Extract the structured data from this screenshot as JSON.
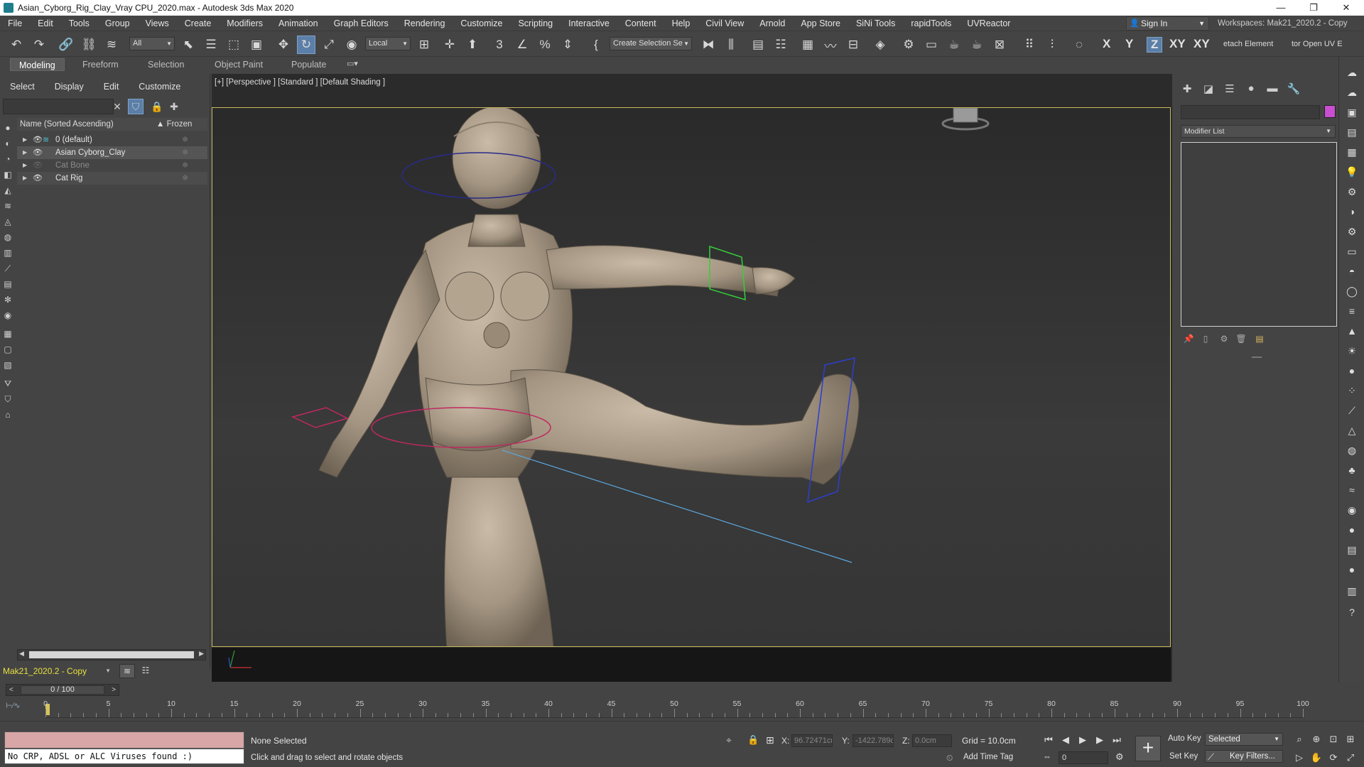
{
  "window": {
    "title": "Asian_Cyborg_Rig_Clay_Vray CPU_2020.max - Autodesk 3ds Max 2020",
    "controls": [
      "—",
      "❐",
      "✕"
    ]
  },
  "menu": [
    "File",
    "Edit",
    "Tools",
    "Group",
    "Views",
    "Create",
    "Modifiers",
    "Animation",
    "Graph Editors",
    "Rendering",
    "Customize",
    "Scripting",
    "Interactive",
    "Content",
    "Help",
    "Civil View",
    "Arnold",
    "App Store",
    "SiNi Tools",
    "rapidTools",
    "UVReactor"
  ],
  "signin": "Sign In",
  "workspaces": {
    "label": "Workspaces:",
    "value": "Mak21_2020.2 - Copy"
  },
  "toolbar": {
    "filter": "All",
    "coord_system": "Local",
    "selection_set": "Create Selection Se",
    "axes": [
      "X",
      "Y",
      "Z",
      "XY",
      "XY"
    ],
    "active_axis": "Z",
    "detach_label": "etach Element",
    "openuv_label": "tor Open UV E"
  },
  "ribbon_tabs": [
    "Modeling",
    "Freeform",
    "Selection",
    "Object Paint",
    "Populate"
  ],
  "ribbon_active": "Modeling",
  "explorer": {
    "menu": [
      "Select",
      "Display",
      "Edit",
      "Customize"
    ],
    "header": {
      "name": "Name (Sorted Ascending)",
      "frozen": "▲ Frozen"
    },
    "rows": [
      {
        "name": "0 (default)",
        "dim": false
      },
      {
        "name": "Asian Cyborg_Clay",
        "dim": false
      },
      {
        "name": "Cat Bone",
        "dim": true
      },
      {
        "name": "Cat Rig",
        "dim": false
      }
    ]
  },
  "layer_dropdown": "Mak21_2020.2 - Copy",
  "viewport": {
    "label": "[+] [Perspective ] [Standard ] [Default Shading ]"
  },
  "command_panel": {
    "modifier_list": "Modifier List",
    "accent_color": "#c94ed0"
  },
  "timeline": {
    "frame_display": "0 / 100",
    "labels": [
      "0",
      "5",
      "10",
      "15",
      "20",
      "25",
      "30",
      "35",
      "40",
      "45",
      "50",
      "55",
      "60",
      "65",
      "70",
      "75",
      "80",
      "85",
      "90",
      "95",
      "100"
    ]
  },
  "status": {
    "maxscript_output": "No CRP, ADSL or ALC Viruses found :)",
    "selection": "None Selected",
    "prompt": "Click and drag to select and rotate objects",
    "x_label": "X:",
    "x_value": "96.72471cm",
    "y_label": "Y:",
    "y_value": "-1422.789c",
    "z_label": "Z:",
    "z_value": "0.0cm",
    "grid": "Grid = 10.0cm",
    "add_time_tag": "Add Time Tag",
    "current_frame": "0",
    "auto_key": "Auto Key",
    "set_key": "Set Key",
    "key_mode": "Selected",
    "key_filters": "Key Filters..."
  }
}
